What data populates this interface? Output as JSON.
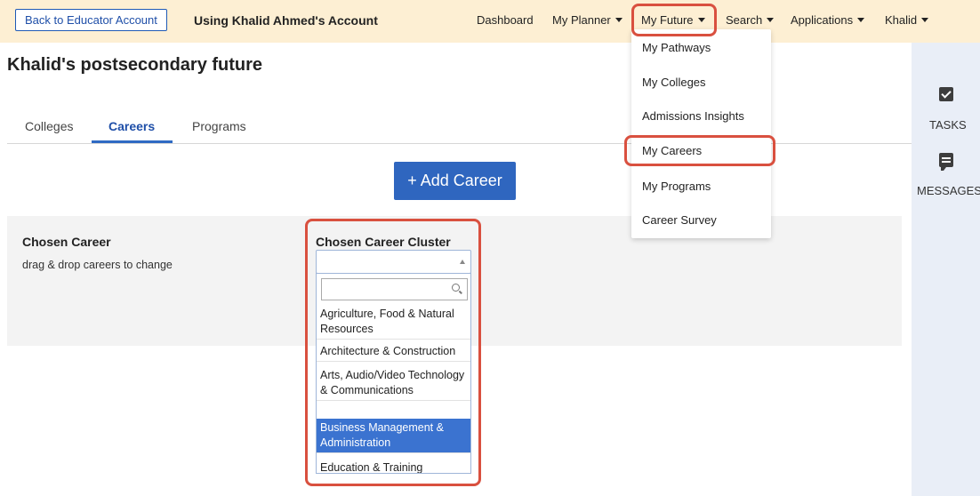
{
  "topbar": {
    "back_label": "Back to Educator Account",
    "using_label": "Using Khalid Ahmed's Account",
    "nav": {
      "dashboard": "Dashboard",
      "planner": "My Planner",
      "future": "My Future",
      "search": "Search",
      "applications": "Applications",
      "user": "Khalid"
    }
  },
  "future_menu": {
    "items": [
      "My Pathways",
      "My Colleges",
      "Admissions Insights",
      "My Careers",
      "My Programs",
      "Career Survey"
    ],
    "highlighted": "My Careers"
  },
  "rail": {
    "tasks_label": "TASKS",
    "messages_label": "MESSAGES"
  },
  "main": {
    "title": "Khalid's postsecondary future",
    "tabs": [
      {
        "label": "Colleges",
        "active": false
      },
      {
        "label": "Careers",
        "active": true
      },
      {
        "label": "Programs",
        "active": false
      }
    ],
    "add_career_label": "+ Add Career",
    "chosen_career": {
      "heading": "Chosen Career",
      "hint": "drag & drop careers to change"
    },
    "cluster": {
      "heading": "Chosen Career Cluster",
      "selected_value": "",
      "search_value": "",
      "options": [
        "Agriculture, Food & Natural Resources",
        "Architecture & Construction",
        "Arts, Audio/Video Technology & Communications",
        "Business Management & Administration",
        "Education & Training"
      ],
      "highlighted_option": "Business Management & Administration"
    }
  },
  "colors": {
    "topbar_bg": "#fdefd3",
    "accent_blue": "#2f66bf",
    "highlight_red": "#d9503f",
    "rail_bg": "#e9eef7"
  }
}
